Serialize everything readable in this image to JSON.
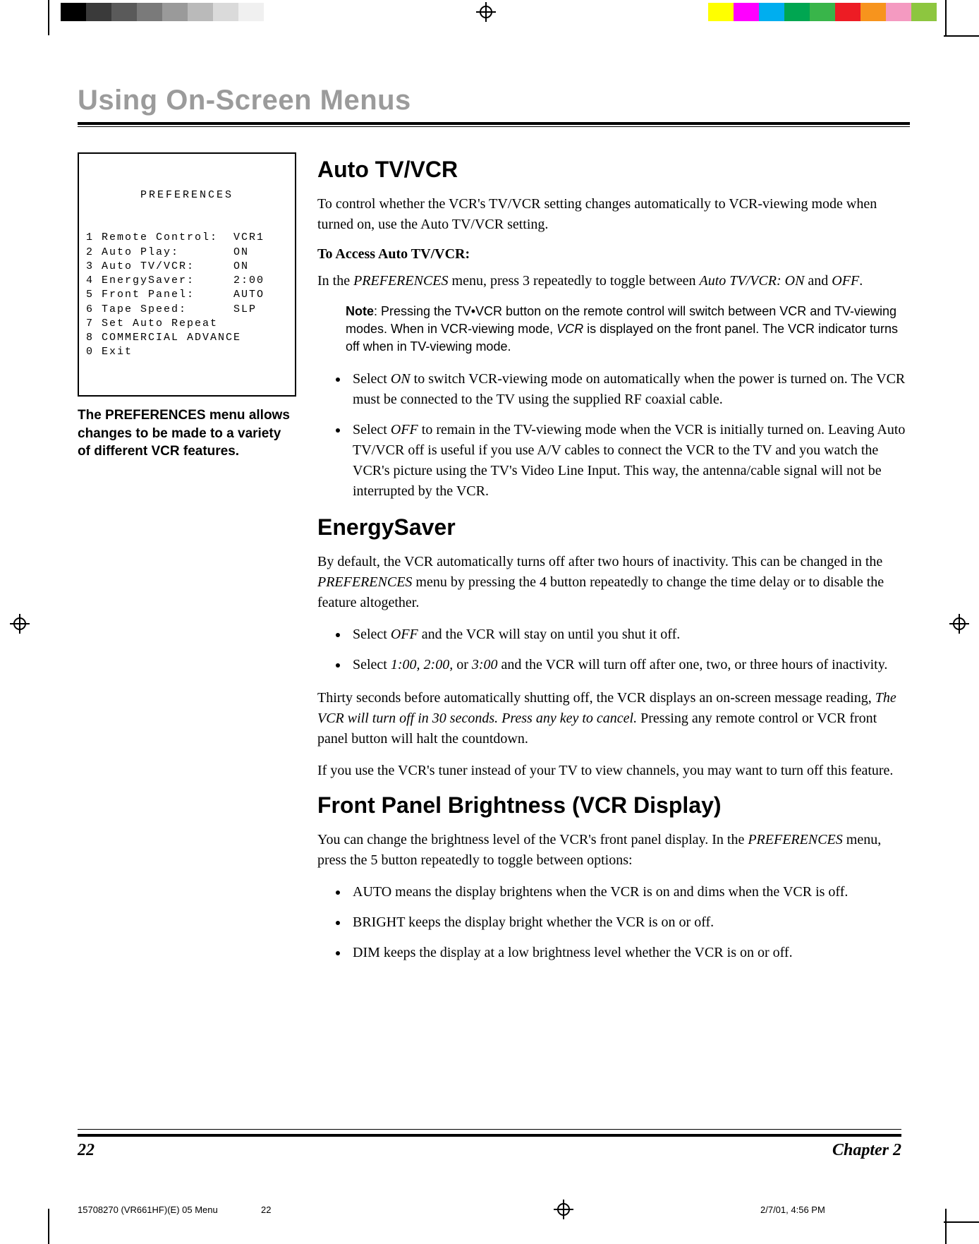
{
  "chapter_title": "Using On-Screen Menus",
  "prefs_box": {
    "title": "PREFERENCES",
    "rows": [
      {
        "n": "1",
        "label": "Remote Control:",
        "val": "VCR1"
      },
      {
        "n": "2",
        "label": "Auto Play:",
        "val": "ON"
      },
      {
        "n": "3",
        "label": "Auto TV/VCR:",
        "val": "ON"
      },
      {
        "n": "4",
        "label": "EnergySaver:",
        "val": "2:00"
      },
      {
        "n": "5",
        "label": "Front Panel:",
        "val": "AUTO"
      },
      {
        "n": "6",
        "label": "Tape Speed:",
        "val": "SLP"
      },
      {
        "n": "7",
        "label": "Set Auto Repeat",
        "val": ""
      },
      {
        "n": "8",
        "label": "COMMERCIAL ADVANCE",
        "val": ""
      },
      {
        "n": "0",
        "label": "Exit",
        "val": ""
      }
    ]
  },
  "caption": "The PREFERENCES menu allows changes to be made to a variety of different VCR features.",
  "s1": {
    "heading": "Auto TV/VCR",
    "p1": "To control whether the VCR's TV/VCR setting changes automatically to VCR-viewing mode when turned on, use the Auto TV/VCR setting.",
    "sub": "To Access Auto TV/VCR:",
    "p2a": "In the ",
    "p2b": "PREFERENCES",
    "p2c": " menu, press 3 repeatedly to toggle between ",
    "p2d": "Auto TV/VCR: ON",
    "p2e": " and ",
    "p2f": "OFF",
    "p2g": ".",
    "note_label": "Note",
    "note_body": ": Pressing the TV•VCR button on the remote control will switch between VCR and TV-viewing modes. When in VCR-viewing mode, ",
    "note_vcr": "VCR",
    "note_body2": " is displayed on the front panel. The VCR indicator turns off when in TV-viewing mode.",
    "b1a": "Select ",
    "b1b": "ON",
    "b1c": " to switch VCR-viewing mode on automatically when the power is turned on. The VCR must be connected to the TV using the supplied RF coaxial cable.",
    "b2a": "Select ",
    "b2b": "OFF",
    "b2c": " to remain in the TV-viewing mode when the VCR is initially turned on. Leaving Auto TV/VCR off is useful if you use A/V cables to connect the VCR to the TV and you watch the VCR's picture using the TV's Video Line Input. This way, the antenna/cable signal will not be interrupted by the VCR."
  },
  "s2": {
    "heading": "EnergySaver",
    "p1a": "By default, the VCR automatically turns off after two hours of inactivity. This can be changed in the ",
    "p1b": "PREFERENCES",
    "p1c": " menu by pressing the 4 button repeatedly to change the time delay or to disable the feature altogether.",
    "b1a": "Select ",
    "b1b": "OFF",
    "b1c": " and the VCR will stay on until you shut it off.",
    "b2a": "Select ",
    "b2b": "1:00, 2:00,",
    "b2c": " or ",
    "b2d": "3:00",
    "b2e": " and the VCR will turn off after one, two, or three hours of inactivity.",
    "p2a": "Thirty seconds before automatically shutting off, the VCR displays an on-screen message reading, ",
    "p2b": "The VCR will turn off in 30 seconds. Press any key to cancel.",
    "p2c": " Pressing any remote control or VCR front panel button will halt the countdown.",
    "p3": "If you use the VCR's tuner instead of your TV to view channels, you may want to turn off this feature."
  },
  "s3": {
    "heading": "Front Panel Brightness (VCR Display)",
    "p1a": "You can change the brightness level of the VCR's front panel display. In the ",
    "p1b": "PREFERENCES",
    "p1c": " menu, press the 5 button repeatedly to toggle between options:",
    "b1": "AUTO means the display brightens when the VCR is on and dims when the VCR is off.",
    "b2": "BRIGHT keeps the display bright whether the VCR is on or off.",
    "b3": "DIM keeps the display at a low brightness level whether the VCR is on or off."
  },
  "footer": {
    "page": "22",
    "chapter": "Chapter 2"
  },
  "job": {
    "file": "15708270 (VR661HF)(E) 05 Menu",
    "pg": "22",
    "ts": "2/7/01, 4:56 PM"
  },
  "color_bars_left": [
    "#000000",
    "#3a3a3a",
    "#5a5a5a",
    "#7a7a7a",
    "#9a9a9a",
    "#bababa",
    "#dadada",
    "#f0f0f0"
  ],
  "color_bars_right": [
    "#ffff00",
    "#ff00ff",
    "#00aeef",
    "#00a651",
    "#39b54a",
    "#ed1c24",
    "#f7941d",
    "#f49ac1",
    "#8dc63f"
  ]
}
